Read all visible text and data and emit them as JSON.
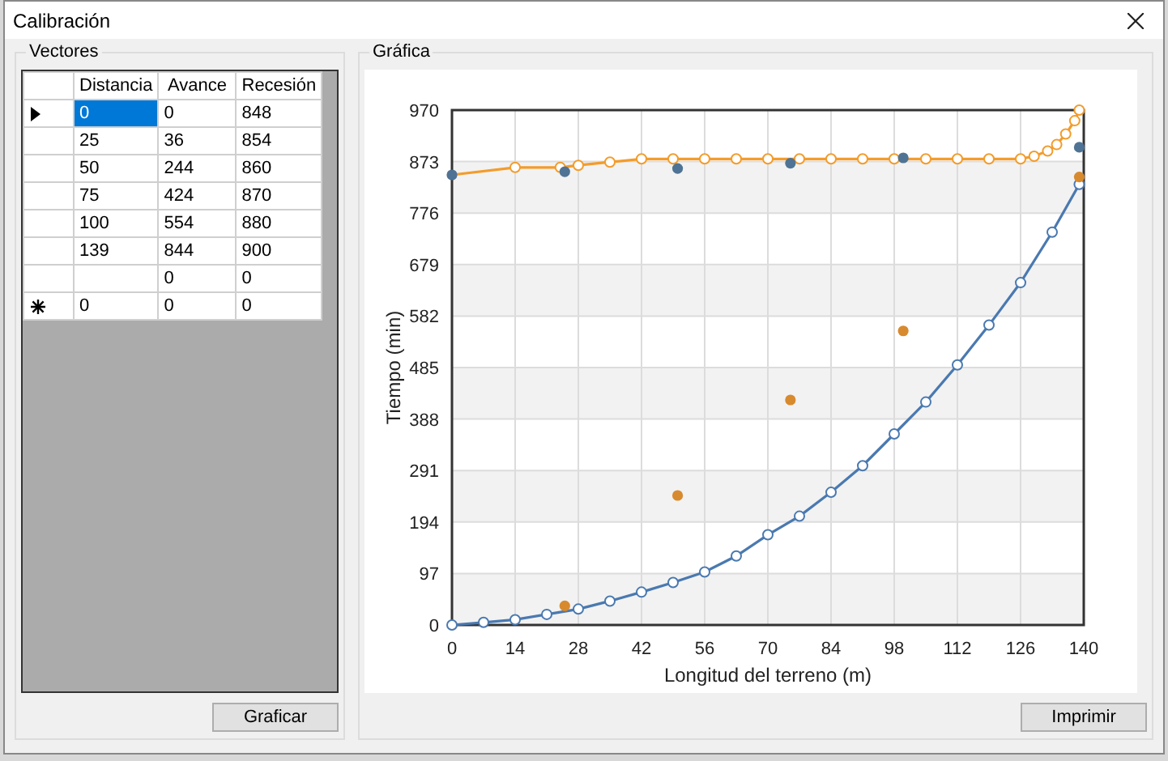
{
  "window": {
    "title": "Calibración"
  },
  "vectors": {
    "title": "Vectores",
    "columns": [
      "Distancia",
      "Avance",
      "Recesión"
    ],
    "rows": [
      {
        "current": true,
        "new_row": false,
        "cells": [
          {
            "text": "0",
            "selected": true
          },
          {
            "text": "0",
            "selected": false
          },
          {
            "text": "848",
            "selected": false
          }
        ]
      },
      {
        "current": false,
        "new_row": false,
        "cells": [
          {
            "text": "25",
            "selected": false
          },
          {
            "text": "36",
            "selected": false
          },
          {
            "text": "854",
            "selected": false
          }
        ]
      },
      {
        "current": false,
        "new_row": false,
        "cells": [
          {
            "text": "50",
            "selected": false
          },
          {
            "text": "244",
            "selected": false
          },
          {
            "text": "860",
            "selected": false
          }
        ]
      },
      {
        "current": false,
        "new_row": false,
        "cells": [
          {
            "text": "75",
            "selected": false
          },
          {
            "text": "424",
            "selected": false
          },
          {
            "text": "870",
            "selected": false
          }
        ]
      },
      {
        "current": false,
        "new_row": false,
        "cells": [
          {
            "text": "100",
            "selected": false
          },
          {
            "text": "554",
            "selected": false
          },
          {
            "text": "880",
            "selected": false
          }
        ]
      },
      {
        "current": false,
        "new_row": false,
        "cells": [
          {
            "text": "139",
            "selected": false
          },
          {
            "text": "844",
            "selected": false
          },
          {
            "text": "900",
            "selected": false
          }
        ]
      },
      {
        "current": false,
        "new_row": false,
        "cells": [
          {
            "selected": false
          },
          {
            "text": "0",
            "selected": false
          },
          {
            "text": "0",
            "selected": false
          }
        ]
      },
      {
        "current": false,
        "new_row": true,
        "cells": [
          {
            "text": "0",
            "selected": false
          },
          {
            "text": "0",
            "selected": false
          },
          {
            "text": "0",
            "selected": false
          }
        ]
      }
    ],
    "button": "Graficar"
  },
  "chart_panel": {
    "title": "Gráfica",
    "button": "Imprimir",
    "chart_data": {
      "type": "line",
      "xlabel": "Longitud del terreno (m)",
      "ylabel": "Tiempo (min)",
      "grid": true,
      "xlim": [
        0,
        140
      ],
      "ylim": [
        0,
        970
      ],
      "xticks": [
        0,
        14,
        28,
        42,
        56,
        70,
        84,
        98,
        112,
        126,
        140
      ],
      "yticks": [
        0,
        97,
        194,
        291,
        388,
        485,
        582,
        679,
        776,
        873,
        970
      ],
      "series": [
        {
          "type": "line",
          "marker": true,
          "color": "#f39c2b",
          "x": [
            0,
            14,
            24,
            28,
            35,
            42,
            49,
            56,
            63,
            70,
            77,
            84,
            91,
            98,
            105,
            112,
            119,
            126,
            129,
            132,
            134,
            136,
            138,
            139
          ],
          "values": [
            848,
            862,
            862,
            866,
            872,
            878,
            878,
            878,
            878,
            878,
            878,
            878,
            878,
            878,
            878,
            878,
            878,
            878,
            883,
            893,
            905,
            925,
            950,
            970
          ]
        },
        {
          "type": "line",
          "marker": true,
          "color": "#4a79b0",
          "x": [
            0,
            7,
            14,
            21,
            28,
            35,
            42,
            49,
            56,
            63,
            70,
            77,
            84,
            91,
            98,
            105,
            112,
            119,
            126,
            133,
            139
          ],
          "values": [
            0,
            5,
            10,
            20,
            30,
            45,
            62,
            80,
            100,
            130,
            170,
            205,
            250,
            300,
            360,
            420,
            490,
            565,
            645,
            740,
            830
          ]
        },
        {
          "type": "scatter",
          "color": "#4f7394",
          "x": [
            0,
            25,
            50,
            75,
            100,
            139
          ],
          "values": [
            848,
            854,
            860,
            870,
            880,
            900
          ]
        },
        {
          "type": "scatter",
          "color": "#d88a2e",
          "x": [
            25,
            50,
            75,
            100,
            139
          ],
          "values": [
            36,
            244,
            424,
            554,
            844
          ]
        }
      ]
    }
  }
}
